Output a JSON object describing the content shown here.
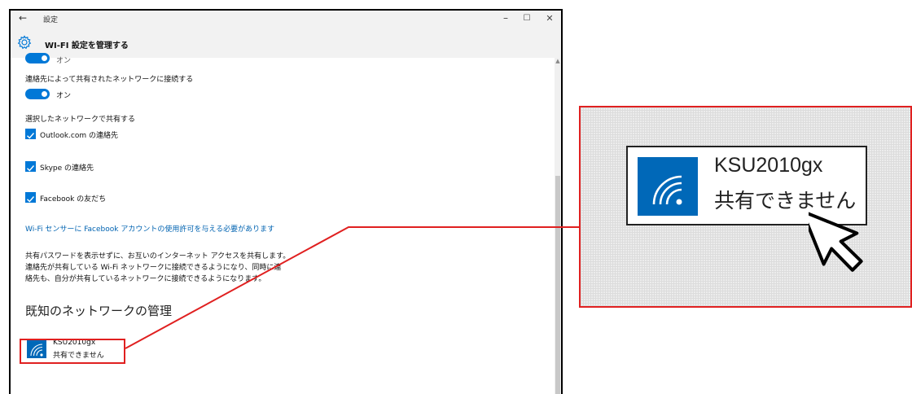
{
  "window": {
    "title": "設定",
    "back_glyph": "←",
    "minimize_glyph": "–",
    "maximize_glyph": "☐",
    "close_glyph": "✕"
  },
  "header": {
    "title": "WI-FI 設定を管理する",
    "icon": "gear-icon"
  },
  "settings": {
    "partial_toggle_label": "オン",
    "contacts_heading": "連絡先によって共有されたネットワークに接続する",
    "contacts_toggle_label": "オン",
    "share_heading": "選択したネットワークで共有する",
    "checkboxes": [
      {
        "label": "Outlook.com の連絡先",
        "checked": true
      },
      {
        "label": "Skype の連絡先",
        "checked": true
      },
      {
        "label": "Facebook の友だち",
        "checked": true
      }
    ],
    "facebook_link": "Wi-Fi センサーに Facebook アカウントの使用許可を与える必要があります",
    "description": [
      "共有パスワードを表示せずに、お互いのインターネット アクセスを共有します。",
      "連絡先が共有している Wi-Fi ネットワークに接続できるようになり、同時に連",
      "絡先も、自分が共有しているネットワークに接続できるようになります。"
    ]
  },
  "known_networks": {
    "title": "既知のネットワークの管理",
    "items": [
      {
        "name": "KSU2010gx",
        "status": "共有できません",
        "icon": "wifi-icon"
      }
    ]
  },
  "zoom_callout": {
    "name": "KSU2010gx",
    "status": "共有できません",
    "icon": "wifi-icon",
    "cursor_icon": "arrow-cursor-icon"
  },
  "colors": {
    "accent": "#0078d7",
    "tile": "#0068b8",
    "highlight": "#e02020",
    "link": "#0063b1"
  }
}
